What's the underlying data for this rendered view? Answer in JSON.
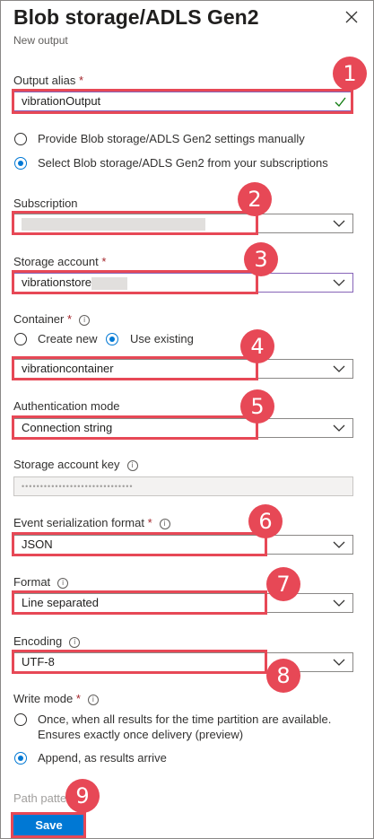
{
  "header": {
    "title": "Blob storage/ADLS Gen2",
    "subtitle": "New output"
  },
  "output_alias": {
    "label": "Output alias",
    "required_mark": "*",
    "value": "vibrationOutput"
  },
  "config_mode": {
    "option_manual": "Provide Blob storage/ADLS Gen2 settings manually",
    "option_subscription": "Select Blob storage/ADLS Gen2 from your subscriptions",
    "selected": "subscription"
  },
  "subscription": {
    "label": "Subscription",
    "value": ""
  },
  "storage_account": {
    "label": "Storage account",
    "required_mark": "*",
    "value": "vibrationstore"
  },
  "container": {
    "label": "Container",
    "required_mark": "*",
    "option_new": "Create new",
    "option_existing": "Use existing",
    "selected": "existing",
    "value": "vibrationcontainer"
  },
  "auth_mode": {
    "label": "Authentication mode",
    "value": "Connection string"
  },
  "storage_key": {
    "label": "Storage account key",
    "value": "••••••••••••••••••••••••••••••"
  },
  "serialization": {
    "label": "Event serialization format",
    "required_mark": "*",
    "value": "JSON"
  },
  "format": {
    "label": "Format",
    "value": "Line separated"
  },
  "encoding": {
    "label": "Encoding",
    "value": "UTF-8"
  },
  "write_mode": {
    "label": "Write mode",
    "required_mark": "*",
    "option_once_line1": "Once, when all results for the time partition are available.",
    "option_once_line2": "Ensures exactly once delivery (preview)",
    "option_append": "Append, as results arrive",
    "selected": "append"
  },
  "path_label_partial": "Path pattern",
  "save_label": "Save",
  "callouts": [
    "1",
    "2",
    "3",
    "4",
    "5",
    "6",
    "7",
    "8",
    "9"
  ],
  "colors": {
    "accent": "#0078d4",
    "highlight": "#e74856",
    "required": "#a4262c",
    "success": "#107c10"
  },
  "icons": {
    "close": "close-icon",
    "chevron": "chevron-down-icon",
    "check": "checkmark-icon",
    "info": "info-icon"
  }
}
